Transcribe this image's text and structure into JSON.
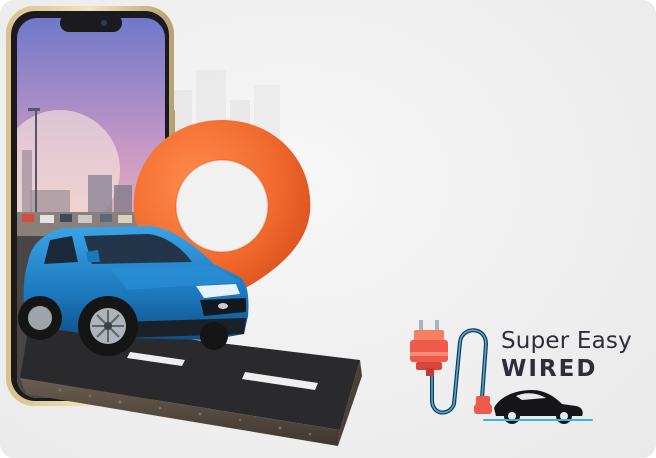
{
  "badge": {
    "line1": "Super Easy",
    "line2": "WIRED",
    "icon": "plug-cable-car-icon"
  },
  "illustration": {
    "phone": "smartphone-icon",
    "pin": "location-pin-icon",
    "car": "suv-icon",
    "road": "road-tile"
  },
  "colors": {
    "accent": "#f26a2e",
    "plug": "#ef5a4a",
    "cable": "#22334d",
    "car_body": "#1f7fc4",
    "text": "#2e2e3a"
  }
}
